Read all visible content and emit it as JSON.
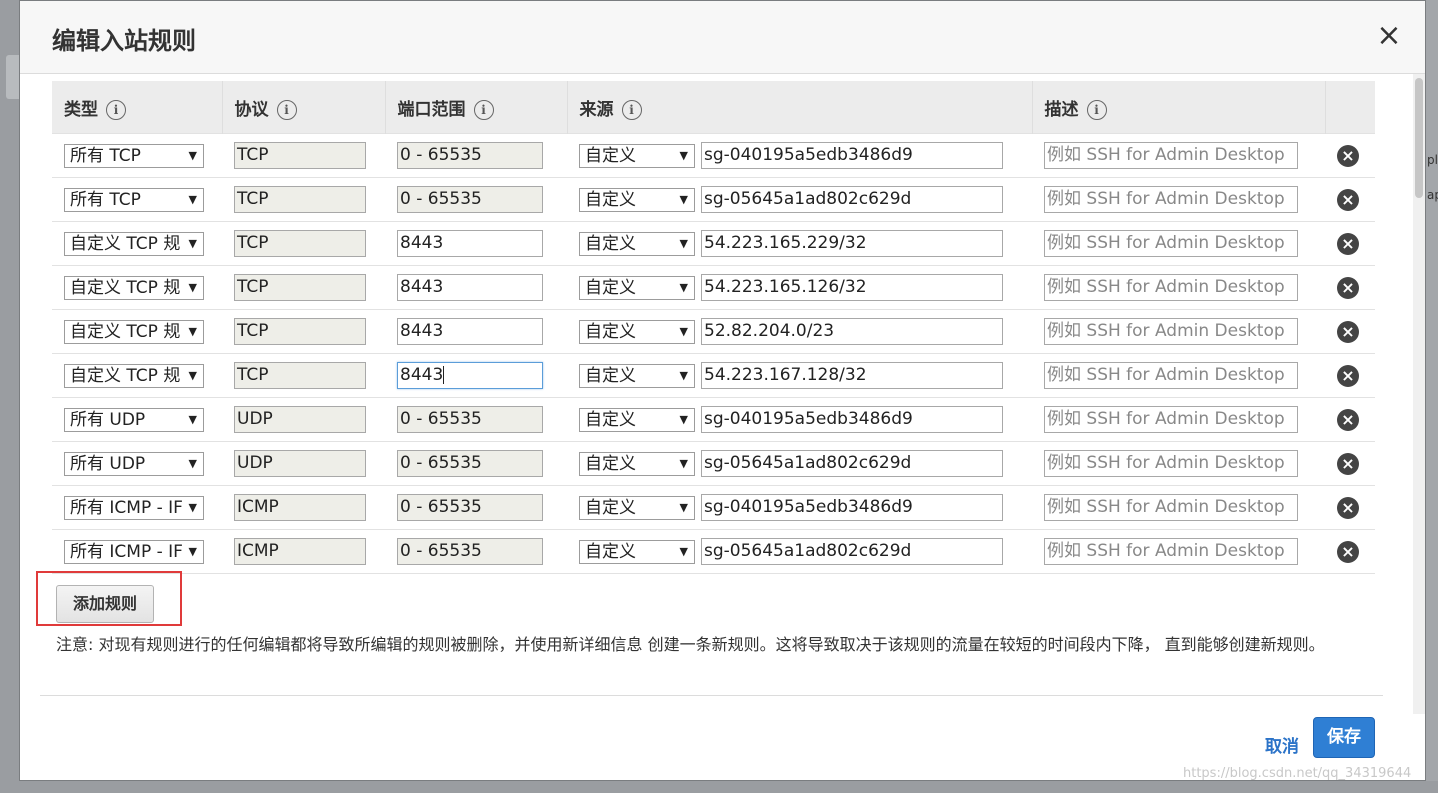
{
  "dialog": {
    "title": "编辑入站规则",
    "close_label": "×"
  },
  "table": {
    "headers": [
      "类型",
      "协议",
      "端口范围",
      "来源",
      "描述"
    ],
    "info_glyph": "i",
    "remove_glyph": "×",
    "rows": [
      {
        "type": "所有 TCP",
        "protocol": "TCP",
        "port": "0 - 65535",
        "port_editable": false,
        "source_type": "自定义",
        "source": "sg-040195a5edb3486d9",
        "desc_placeholder": "例如 SSH for Admin Desktop"
      },
      {
        "type": "所有 TCP",
        "protocol": "TCP",
        "port": "0 - 65535",
        "port_editable": false,
        "source_type": "自定义",
        "source": "sg-05645a1ad802c629d",
        "desc_placeholder": "例如 SSH for Admin Desktop"
      },
      {
        "type": "自定义 TCP 规",
        "protocol": "TCP",
        "port": "8443",
        "port_editable": true,
        "source_type": "自定义",
        "source": "54.223.165.229/32",
        "desc_placeholder": "例如 SSH for Admin Desktop"
      },
      {
        "type": "自定义 TCP 规",
        "protocol": "TCP",
        "port": "8443",
        "port_editable": true,
        "source_type": "自定义",
        "source": "54.223.165.126/32",
        "desc_placeholder": "例如 SSH for Admin Desktop"
      },
      {
        "type": "自定义 TCP 规",
        "protocol": "TCP",
        "port": "8443",
        "port_editable": true,
        "source_type": "自定义",
        "source": "52.82.204.0/23",
        "desc_placeholder": "例如 SSH for Admin Desktop"
      },
      {
        "type": "自定义 TCP 规",
        "protocol": "TCP",
        "port": "8443",
        "port_editable": true,
        "focused": true,
        "source_type": "自定义",
        "source": "54.223.167.128/32",
        "desc_placeholder": "例如 SSH for Admin Desktop"
      },
      {
        "type": "所有 UDP",
        "protocol": "UDP",
        "port": "0 - 65535",
        "port_editable": false,
        "source_type": "自定义",
        "source": "sg-040195a5edb3486d9",
        "desc_placeholder": "例如 SSH for Admin Desktop"
      },
      {
        "type": "所有 UDP",
        "protocol": "UDP",
        "port": "0 - 65535",
        "port_editable": false,
        "source_type": "自定义",
        "source": "sg-05645a1ad802c629d",
        "desc_placeholder": "例如 SSH for Admin Desktop"
      },
      {
        "type": "所有 ICMP - IF",
        "protocol": "ICMP",
        "port": "0 - 65535",
        "port_editable": false,
        "source_type": "自定义",
        "source": "sg-040195a5edb3486d9",
        "desc_placeholder": "例如 SSH for Admin Desktop"
      },
      {
        "type": "所有 ICMP - IF",
        "protocol": "ICMP",
        "port": "0 - 65535",
        "port_editable": false,
        "source_type": "自定义",
        "source": "sg-05645a1ad802c629d",
        "desc_placeholder": "例如 SSH for Admin Desktop"
      }
    ]
  },
  "actions": {
    "add_rule": "添加规则",
    "cancel": "取消",
    "save": "保存"
  },
  "note": "注意: 对现有规则进行的任何编辑都将导致所编辑的规则被删除，并使用新详细信息 创建一条新规则。这将导致取决于该规则的流量在较短的时间段内下降， 直到能够创建新规则。",
  "background": {
    "right_fragments": [
      "pl",
      "ap"
    ]
  },
  "watermark": "https://blog.csdn.net/qq_34319644",
  "colors": {
    "primary": "#2f7fd4",
    "link": "#2b73c8",
    "highlight_border": "#e03a3a",
    "readonly_field": "#eeeee8"
  }
}
